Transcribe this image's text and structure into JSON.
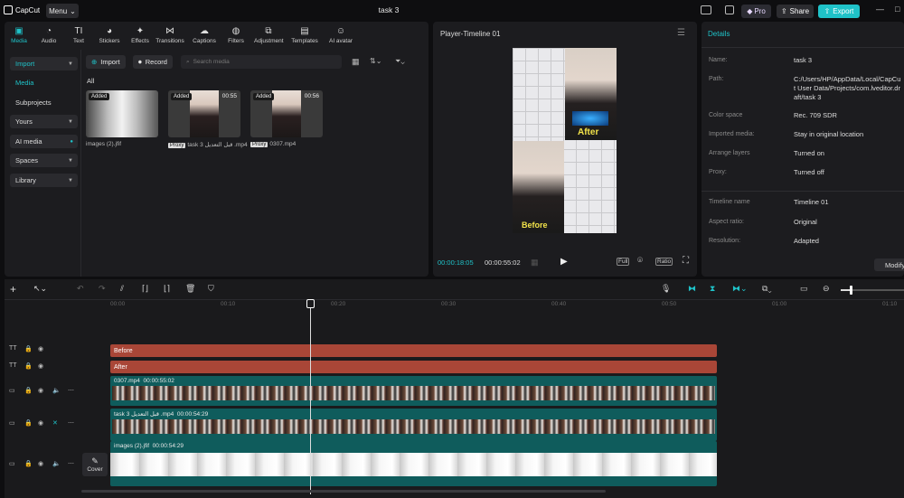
{
  "app": {
    "logo_text": "CapCut",
    "menu_label": "Menu",
    "window_title": "task 3",
    "pro_label": "Pro",
    "share_label": "Share",
    "export_label": "Export"
  },
  "toolbar_tabs": [
    {
      "label": "Media",
      "icon": "media-icon",
      "active": true
    },
    {
      "label": "Audio",
      "icon": "audio-icon"
    },
    {
      "label": "Text",
      "icon": "text-icon"
    },
    {
      "label": "Stickers",
      "icon": "stickers-icon"
    },
    {
      "label": "Effects",
      "icon": "effects-icon"
    },
    {
      "label": "Transitions",
      "icon": "transitions-icon"
    },
    {
      "label": "Captions",
      "icon": "captions-icon"
    },
    {
      "label": "Filters",
      "icon": "filters-icon"
    },
    {
      "label": "Adjustment",
      "icon": "adjustment-icon"
    },
    {
      "label": "Templates",
      "icon": "templates-icon"
    },
    {
      "label": "AI avatar",
      "icon": "ai-avatar-icon"
    }
  ],
  "sidebar": {
    "import": "Import",
    "media": "Media",
    "subprojects": "Subprojects",
    "yours": "Yours",
    "ai_media": "AI media",
    "spaces": "Spaces",
    "library": "Library"
  },
  "media": {
    "import_btn": "Import",
    "record_btn": "Record",
    "search_placeholder": "Search media",
    "filter_all": "All",
    "items": [
      {
        "badge": "Added",
        "duration": "",
        "name": "images (2).jfif",
        "proxy": ""
      },
      {
        "badge": "Added",
        "duration": "00:55",
        "name": "task 3 قبل التعديل .mp4",
        "proxy": "Proxy"
      },
      {
        "badge": "Added",
        "duration": "00:56",
        "name": "0307.mp4",
        "proxy": "Proxy"
      }
    ]
  },
  "player": {
    "title": "Player-Timeline 01",
    "current_time": "00:00:18:05",
    "total_time": "00:00:55:02",
    "full_label": "Full",
    "ratio_label": "Ratio",
    "after_caption": "After",
    "before_caption": "Before"
  },
  "details": {
    "title": "Details",
    "modify_label": "Modify",
    "rows": [
      {
        "label": "Name:",
        "value": "task 3"
      },
      {
        "label": "Path:",
        "value": "C:/Users/HP/AppData/Local/CapCut User Data/Projects/com.lveditor.draft/task 3"
      },
      {
        "label": "Color space",
        "value": "Rec. 709 SDR"
      },
      {
        "label": "Imported media:",
        "value": "Stay in original location"
      },
      {
        "label": "Arrange layers",
        "value": "Turned on"
      },
      {
        "label": "Proxy:",
        "value": "Turned off"
      },
      {
        "label": "Timeline name",
        "value": "Timeline 01"
      },
      {
        "label": "Aspect ratio:",
        "value": "Original"
      },
      {
        "label": "Resolution:",
        "value": "Adapted"
      }
    ]
  },
  "timeline": {
    "ticks": [
      "00:00",
      "00:10",
      "00:20",
      "00:30",
      "00:40",
      "00:50",
      "01:00",
      "01:10"
    ],
    "text_clips": [
      "Before",
      "After"
    ],
    "video_clips": [
      {
        "name": "0307.mp4",
        "duration": "00:00:55:02"
      },
      {
        "name": "task 3 قبل التعديل .mp4",
        "duration": "00:00:54:29"
      },
      {
        "name": "images (2).jfif",
        "duration": "00:00:54:29"
      }
    ],
    "cover_label": "Cover"
  },
  "colors": {
    "accent": "#1fc2c8",
    "text_clip": "#a94637",
    "video_clip": "#0f5c5c"
  }
}
